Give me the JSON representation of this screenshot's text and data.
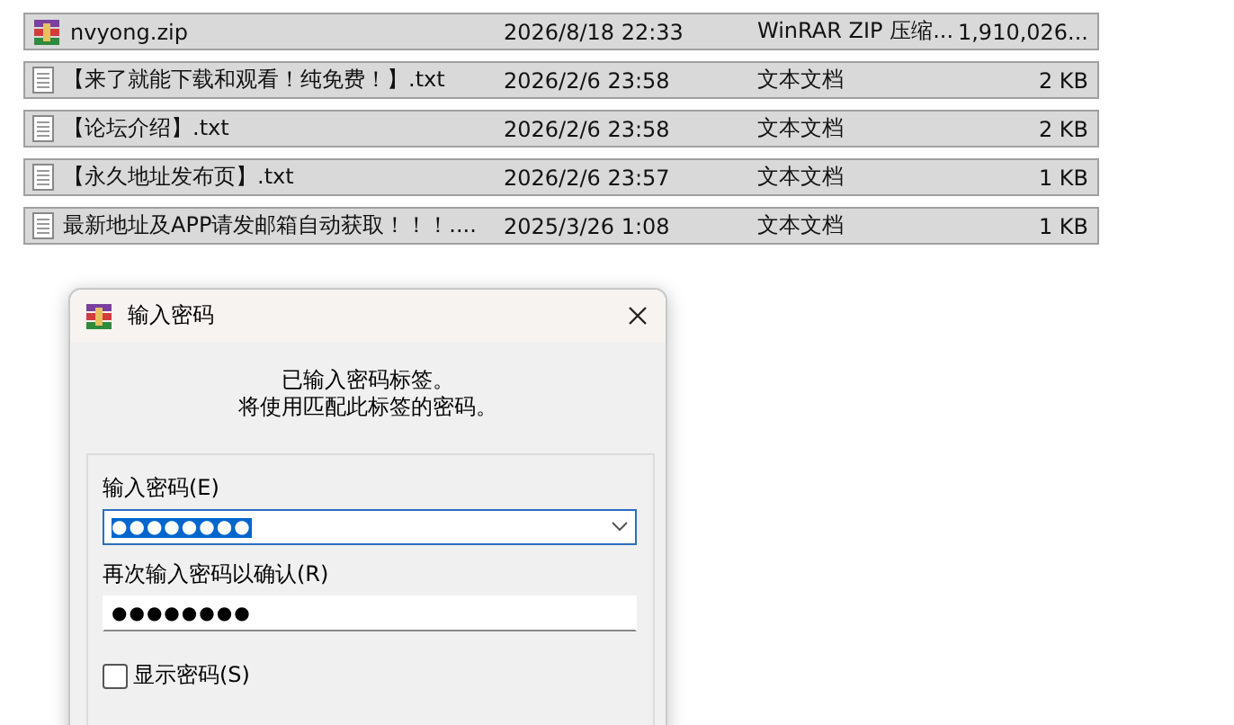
{
  "files": [
    {
      "kind": "archive",
      "name": "nvyong.zip",
      "modified": "2026/8/18 22:33",
      "type": "WinRAR ZIP 压缩...",
      "size": "1,910,026...",
      "selected": true
    },
    {
      "kind": "text",
      "name": "【来了就能下载和观看！纯免费！】.txt",
      "modified": "2026/2/6 23:58",
      "type": "文本文档",
      "size": "2 KB",
      "selected": true
    },
    {
      "kind": "text",
      "name": "【论坛介绍】.txt",
      "modified": "2026/2/6 23:58",
      "type": "文本文档",
      "size": "2 KB",
      "selected": true
    },
    {
      "kind": "text",
      "name": "【永久地址发布页】.txt",
      "modified": "2026/2/6 23:57",
      "type": "文本文档",
      "size": "1 KB",
      "selected": true
    },
    {
      "kind": "text",
      "name": "最新地址及APP请发邮箱自动获取！！！....",
      "modified": "2025/3/26 1:08",
      "type": "文本文档",
      "size": "1 KB",
      "selected": true
    }
  ],
  "dialog": {
    "title": "输入密码",
    "message": [
      "已输入密码标签。",
      "将使用匹配此标签的密码。"
    ],
    "password": {
      "label": "输入密码(E)",
      "value": "●●●●●●●●",
      "highlighted": true
    },
    "confirm": {
      "label": "再次输入密码以确认(R)",
      "value": "●●●●●●●●"
    },
    "show_password": {
      "label": "显示密码(S)",
      "checked": false
    }
  }
}
